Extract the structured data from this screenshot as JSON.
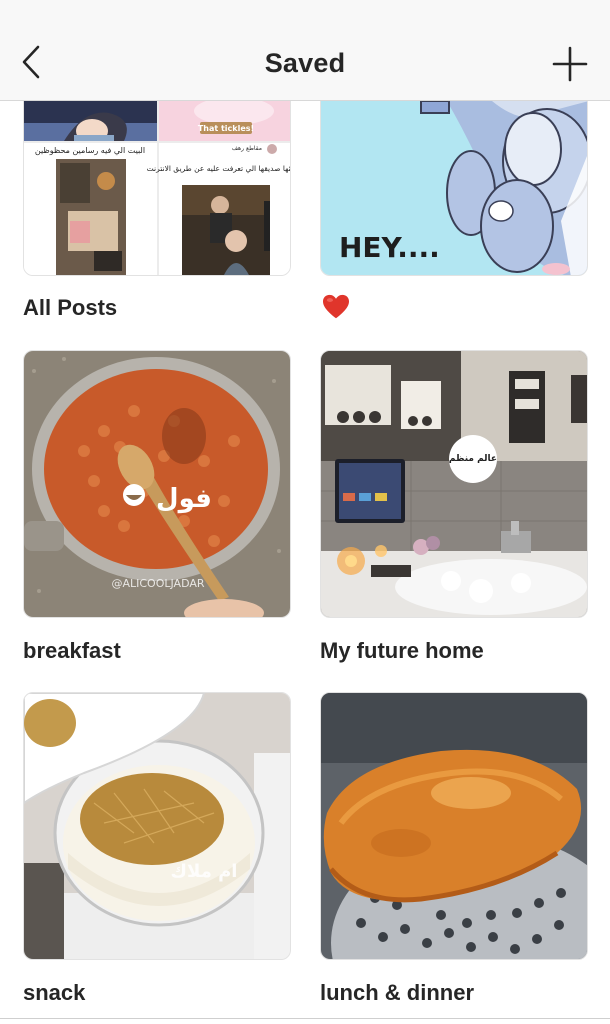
{
  "header": {
    "title": "Saved",
    "back_icon": "chevron-left-icon",
    "add_icon": "plus-icon"
  },
  "collections": [
    {
      "label": "All Posts",
      "thumb_texts": {
        "top_right_caption": "That tickles!",
        "left_caption": "البيت الي فيه رسامين محظوظين",
        "right_user": "مقاطع رهف",
        "right_caption": "فاجئها صديقها الي تعرفت عليه عن طريق الانترنت"
      }
    },
    {
      "label": "",
      "icon": "red-heart-emoji",
      "thumb_texts": {
        "caption": "HEY...."
      }
    },
    {
      "label": "breakfast",
      "thumb_texts": {
        "dish": "فول",
        "watermark": "@ALICOOLJADAR"
      }
    },
    {
      "label": "My future home",
      "thumb_texts": {
        "badge": "عالم منظم"
      }
    },
    {
      "label": "snack",
      "thumb_texts": {
        "watermark": "ام ملاك"
      }
    },
    {
      "label": "lunch & dinner"
    }
  ],
  "colors": {
    "header_bg": "#f8f8f8",
    "text": "#262626",
    "divider": "#d8d8d8",
    "heart": "#e0352b"
  }
}
